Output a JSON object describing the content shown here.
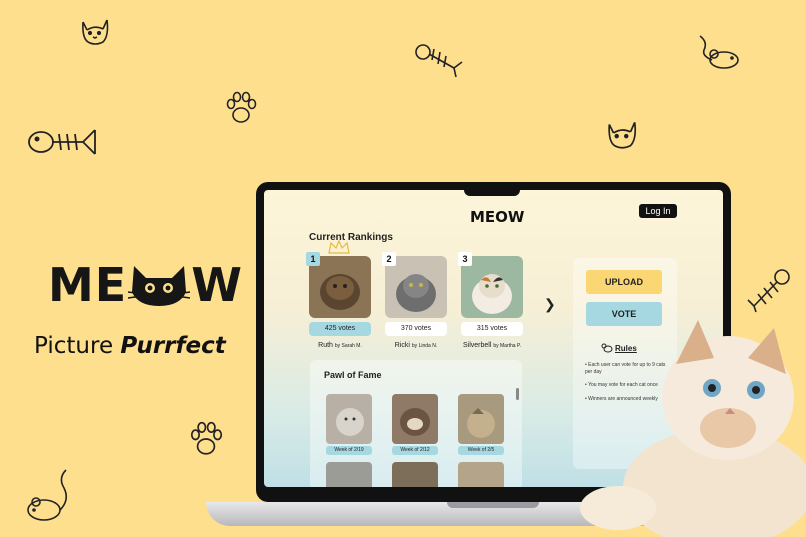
{
  "brand": {
    "logo_left": "ME",
    "logo_right": "W",
    "tagline_plain": "Picture ",
    "tagline_emph": "Purrfect"
  },
  "app": {
    "logo": "MEOW",
    "login_label": "Log In",
    "rankings_title": "Current Rankings",
    "rankings": [
      {
        "rank": "1",
        "votes": "425 votes",
        "name": "Ruth",
        "by": "by Sarah M."
      },
      {
        "rank": "2",
        "votes": "370 votes",
        "name": "Ricki",
        "by": "by Linda N."
      },
      {
        "rank": "3",
        "votes": "315 votes",
        "name": "Silverbell",
        "by": "by Martha P."
      }
    ],
    "upload_label": "UPLOAD",
    "vote_label": "VOTE",
    "rules_title": "Rules",
    "rules": [
      "Each user can vote for up to 9 cats per day",
      "You may vote for each cat once",
      "Winners are announced weekly"
    ],
    "fame_title": "Pawl of Fame",
    "fame": [
      {
        "week": "Week of 2/19"
      },
      {
        "week": "Week of 2/12"
      },
      {
        "week": "Week of 2/5"
      }
    ]
  },
  "colors": {
    "background": "#fddf8e",
    "accent_blue": "#a6d8e2",
    "accent_yellow": "#fbd774"
  },
  "icons": [
    "cat-face-icon",
    "fishbone-icon",
    "mouse-icon",
    "paw-icon",
    "chevron-right-icon",
    "cat-rules-icon",
    "crown-icon"
  ]
}
